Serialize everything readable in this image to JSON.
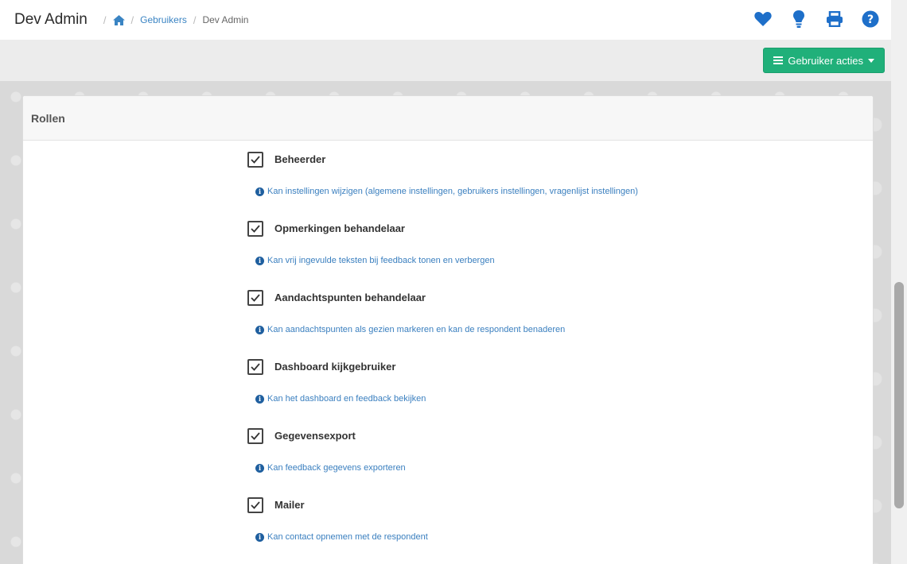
{
  "header": {
    "title": "Dev Admin",
    "breadcrumb": {
      "home_icon": "home-icon",
      "users_label": "Gebruikers",
      "current_label": "Dev Admin",
      "separator": "/"
    },
    "icons": [
      "heart-icon",
      "lightbulb-icon",
      "printer-icon",
      "question-circle-icon"
    ]
  },
  "actions": {
    "button_label": "Gebruiker acties",
    "button_color": "#20b07a"
  },
  "panel": {
    "title": "Rollen",
    "roles": [
      {
        "label": "Beheerder",
        "checked": true,
        "description": "Kan instellingen wijzigen (algemene instellingen, gebruikers instellingen, vragenlijst instellingen)"
      },
      {
        "label": "Opmerkingen behandelaar",
        "checked": true,
        "description": "Kan vrij ingevulde teksten bij feedback tonen en verbergen"
      },
      {
        "label": "Aandachtspunten behandelaar",
        "checked": true,
        "description": "Kan aandachtspunten als gezien markeren en kan de respondent benaderen"
      },
      {
        "label": "Dashboard kijkgebruiker",
        "checked": true,
        "description": "Kan het dashboard en feedback bekijken"
      },
      {
        "label": "Gegevensexport",
        "checked": true,
        "description": "Kan feedback gegevens exporteren"
      },
      {
        "label": "Mailer",
        "checked": true,
        "description": "Kan contact opnemen met de respondent"
      }
    ]
  },
  "colors": {
    "link": "#3a84c3",
    "icon_blue": "#1e6fc9"
  }
}
